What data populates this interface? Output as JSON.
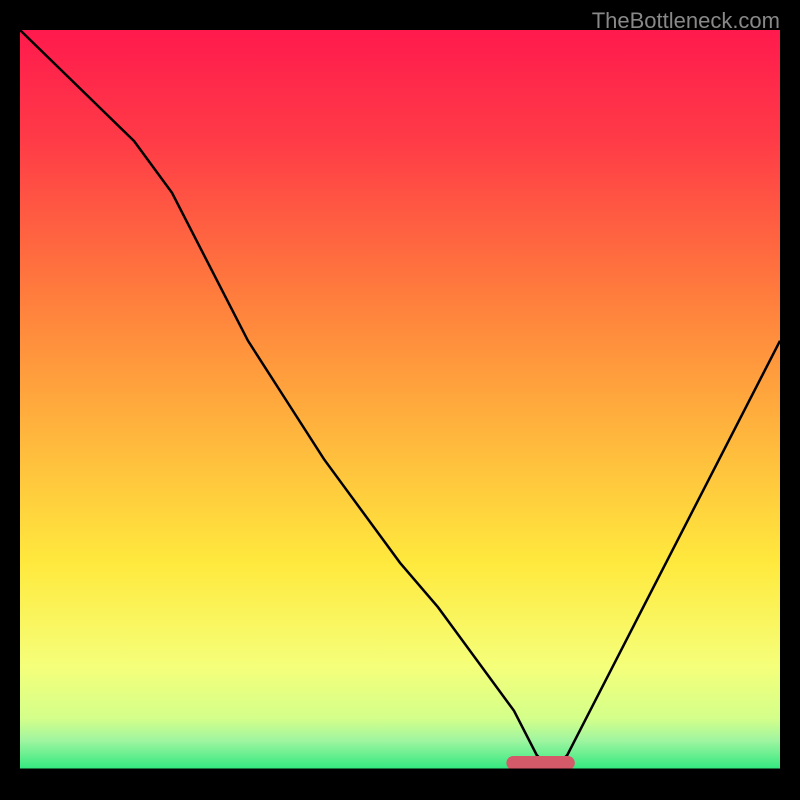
{
  "watermark": "TheBottleneck.com",
  "chart_data": {
    "type": "line",
    "title": "",
    "xlabel": "",
    "ylabel": "",
    "x": [
      0,
      5,
      10,
      15,
      20,
      25,
      30,
      35,
      40,
      45,
      50,
      55,
      60,
      65,
      68,
      70,
      72,
      75,
      80,
      85,
      90,
      95,
      100
    ],
    "values": [
      100,
      95,
      90,
      85,
      78,
      68,
      58,
      50,
      42,
      35,
      28,
      22,
      15,
      8,
      2,
      0,
      2,
      8,
      18,
      28,
      38,
      48,
      58
    ],
    "xlim": [
      0,
      100
    ],
    "ylim": [
      0,
      100
    ],
    "gradient_colors": {
      "top": "#ff1744",
      "mid_top": "#ff6b35",
      "mid": "#ffd93d",
      "mid_bottom": "#f9ff8a",
      "bottom": "#2ee87f"
    },
    "optimal_marker": {
      "x_start": 64,
      "x_end": 73,
      "color": "#d45a6a"
    }
  }
}
